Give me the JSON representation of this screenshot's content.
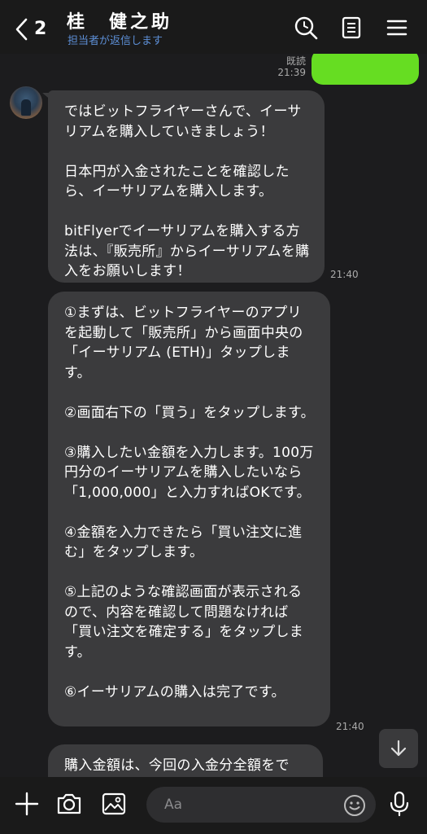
{
  "header": {
    "unread_count": "2",
    "title": "桂　健之助",
    "subtitle": "担当者が返信します"
  },
  "messages": {
    "sent": {
      "read_label": "既読",
      "time": "21:39"
    },
    "received": [
      {
        "text": "ではビットフライヤーさんで、イーサリアムを購入していきましょう！\n\n日本円が入金されたことを確認したら、イーサリアムを購入します。\n\nbitFlyerでイーサリアムを購入する方法は、『販売所』からイーサリアムを購入をお願いします！",
        "time": "21:40"
      },
      {
        "text": "①まずは、ビットフライヤーのアプリを起動して「販売所」から画面中央の「イーサリアム (ETH)」タップします。\n\n②画面右下の「買う」をタップします。\n\n③購入したい金額を入力します。100万円分のイーサリアムを購入したいなら「1,000,000」と入力すればOKです。\n\n④金額を入力できたら「買い注文に進む」をタップします。\n\n⑤上記のような確認画面が表示されるので、内容を確認して問題なければ「買い注文を確定する」をタップします。\n\n⑥イーサリアムの購入は完了です。",
        "time": "21:40"
      },
      {
        "text": "購入金額は、今回の入金分全額をで",
        "time": ""
      }
    ]
  },
  "input": {
    "placeholder": "Aa"
  },
  "colors": {
    "accent": "#5d8fd6",
    "sent_bubble": "#66dd22",
    "received_bubble": "#3b3b3d"
  },
  "icons": [
    "chevron-left-icon",
    "search-icon",
    "notes-icon",
    "menu-icon",
    "plus-icon",
    "camera-icon",
    "image-icon",
    "emoji-icon",
    "microphone-icon",
    "arrow-down-icon"
  ]
}
